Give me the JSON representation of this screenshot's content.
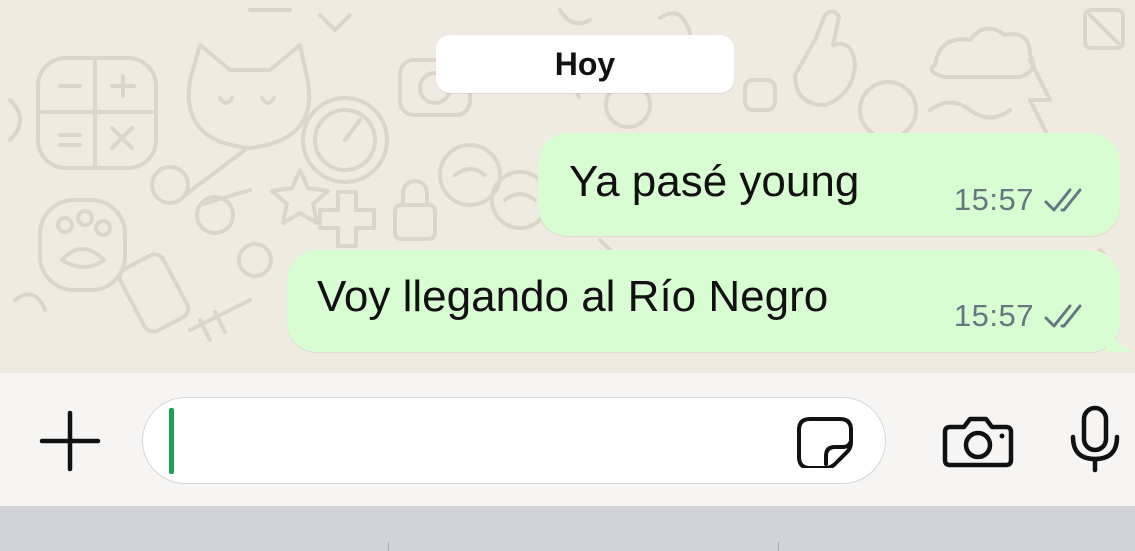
{
  "chat": {
    "date_label": "Hoy",
    "messages": [
      {
        "text": "Ya pasé young",
        "time": "15:57",
        "status": "read"
      },
      {
        "text": "Voy llegando al Río Negro",
        "time": "15:57",
        "status": "read"
      }
    ]
  },
  "composer": {
    "input_value": "",
    "icons": {
      "attach": "plus-icon",
      "sticker": "sticker-icon",
      "camera": "camera-icon",
      "voice": "microphone-icon"
    }
  },
  "colors": {
    "outgoing_bubble": "#d9fdd3",
    "wallpaper": "#efeae2",
    "caret": "#1da05a",
    "meta_text": "#667781"
  }
}
